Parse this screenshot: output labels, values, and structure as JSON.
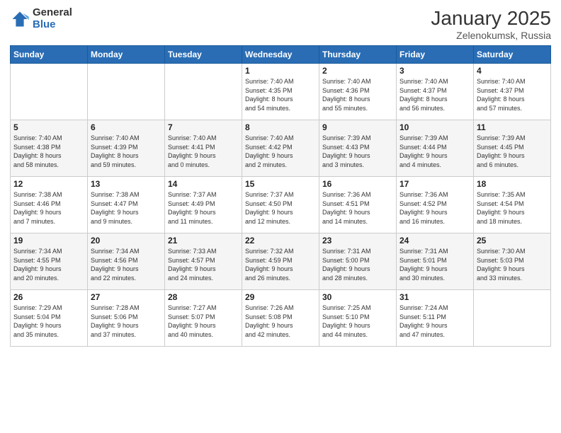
{
  "logo": {
    "general": "General",
    "blue": "Blue"
  },
  "header": {
    "title": "January 2025",
    "subtitle": "Zelenokumsk, Russia"
  },
  "weekdays": [
    "Sunday",
    "Monday",
    "Tuesday",
    "Wednesday",
    "Thursday",
    "Friday",
    "Saturday"
  ],
  "weeks": [
    [
      {
        "day": "",
        "info": ""
      },
      {
        "day": "",
        "info": ""
      },
      {
        "day": "",
        "info": ""
      },
      {
        "day": "1",
        "info": "Sunrise: 7:40 AM\nSunset: 4:35 PM\nDaylight: 8 hours\nand 54 minutes."
      },
      {
        "day": "2",
        "info": "Sunrise: 7:40 AM\nSunset: 4:36 PM\nDaylight: 8 hours\nand 55 minutes."
      },
      {
        "day": "3",
        "info": "Sunrise: 7:40 AM\nSunset: 4:37 PM\nDaylight: 8 hours\nand 56 minutes."
      },
      {
        "day": "4",
        "info": "Sunrise: 7:40 AM\nSunset: 4:37 PM\nDaylight: 8 hours\nand 57 minutes."
      }
    ],
    [
      {
        "day": "5",
        "info": "Sunrise: 7:40 AM\nSunset: 4:38 PM\nDaylight: 8 hours\nand 58 minutes."
      },
      {
        "day": "6",
        "info": "Sunrise: 7:40 AM\nSunset: 4:39 PM\nDaylight: 8 hours\nand 59 minutes."
      },
      {
        "day": "7",
        "info": "Sunrise: 7:40 AM\nSunset: 4:41 PM\nDaylight: 9 hours\nand 0 minutes."
      },
      {
        "day": "8",
        "info": "Sunrise: 7:40 AM\nSunset: 4:42 PM\nDaylight: 9 hours\nand 2 minutes."
      },
      {
        "day": "9",
        "info": "Sunrise: 7:39 AM\nSunset: 4:43 PM\nDaylight: 9 hours\nand 3 minutes."
      },
      {
        "day": "10",
        "info": "Sunrise: 7:39 AM\nSunset: 4:44 PM\nDaylight: 9 hours\nand 4 minutes."
      },
      {
        "day": "11",
        "info": "Sunrise: 7:39 AM\nSunset: 4:45 PM\nDaylight: 9 hours\nand 6 minutes."
      }
    ],
    [
      {
        "day": "12",
        "info": "Sunrise: 7:38 AM\nSunset: 4:46 PM\nDaylight: 9 hours\nand 7 minutes."
      },
      {
        "day": "13",
        "info": "Sunrise: 7:38 AM\nSunset: 4:47 PM\nDaylight: 9 hours\nand 9 minutes."
      },
      {
        "day": "14",
        "info": "Sunrise: 7:37 AM\nSunset: 4:49 PM\nDaylight: 9 hours\nand 11 minutes."
      },
      {
        "day": "15",
        "info": "Sunrise: 7:37 AM\nSunset: 4:50 PM\nDaylight: 9 hours\nand 12 minutes."
      },
      {
        "day": "16",
        "info": "Sunrise: 7:36 AM\nSunset: 4:51 PM\nDaylight: 9 hours\nand 14 minutes."
      },
      {
        "day": "17",
        "info": "Sunrise: 7:36 AM\nSunset: 4:52 PM\nDaylight: 9 hours\nand 16 minutes."
      },
      {
        "day": "18",
        "info": "Sunrise: 7:35 AM\nSunset: 4:54 PM\nDaylight: 9 hours\nand 18 minutes."
      }
    ],
    [
      {
        "day": "19",
        "info": "Sunrise: 7:34 AM\nSunset: 4:55 PM\nDaylight: 9 hours\nand 20 minutes."
      },
      {
        "day": "20",
        "info": "Sunrise: 7:34 AM\nSunset: 4:56 PM\nDaylight: 9 hours\nand 22 minutes."
      },
      {
        "day": "21",
        "info": "Sunrise: 7:33 AM\nSunset: 4:57 PM\nDaylight: 9 hours\nand 24 minutes."
      },
      {
        "day": "22",
        "info": "Sunrise: 7:32 AM\nSunset: 4:59 PM\nDaylight: 9 hours\nand 26 minutes."
      },
      {
        "day": "23",
        "info": "Sunrise: 7:31 AM\nSunset: 5:00 PM\nDaylight: 9 hours\nand 28 minutes."
      },
      {
        "day": "24",
        "info": "Sunrise: 7:31 AM\nSunset: 5:01 PM\nDaylight: 9 hours\nand 30 minutes."
      },
      {
        "day": "25",
        "info": "Sunrise: 7:30 AM\nSunset: 5:03 PM\nDaylight: 9 hours\nand 33 minutes."
      }
    ],
    [
      {
        "day": "26",
        "info": "Sunrise: 7:29 AM\nSunset: 5:04 PM\nDaylight: 9 hours\nand 35 minutes."
      },
      {
        "day": "27",
        "info": "Sunrise: 7:28 AM\nSunset: 5:06 PM\nDaylight: 9 hours\nand 37 minutes."
      },
      {
        "day": "28",
        "info": "Sunrise: 7:27 AM\nSunset: 5:07 PM\nDaylight: 9 hours\nand 40 minutes."
      },
      {
        "day": "29",
        "info": "Sunrise: 7:26 AM\nSunset: 5:08 PM\nDaylight: 9 hours\nand 42 minutes."
      },
      {
        "day": "30",
        "info": "Sunrise: 7:25 AM\nSunset: 5:10 PM\nDaylight: 9 hours\nand 44 minutes."
      },
      {
        "day": "31",
        "info": "Sunrise: 7:24 AM\nSunset: 5:11 PM\nDaylight: 9 hours\nand 47 minutes."
      },
      {
        "day": "",
        "info": ""
      }
    ]
  ]
}
